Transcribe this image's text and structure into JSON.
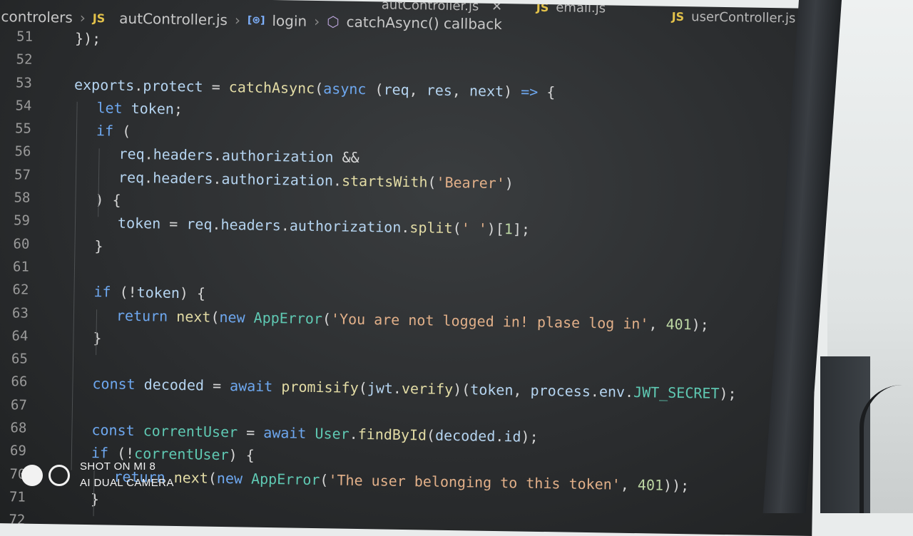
{
  "tabs": [
    {
      "label": "autController.js",
      "active": true,
      "closable": true
    },
    {
      "label": "email.js",
      "active": false
    },
    {
      "label": "userController.js",
      "active": false
    }
  ],
  "breadcrumb": {
    "folder": "controlers",
    "file": "autController.js",
    "symbol": "login",
    "callback": "catchAsync() callback"
  },
  "code": [
    {
      "n": "51",
      "indent": 0,
      "tokens": [
        [
          "pun",
          "});"
        ]
      ]
    },
    {
      "n": "52",
      "indent": 0,
      "tokens": []
    },
    {
      "n": "53",
      "indent": 0,
      "tokens": [
        [
          "var",
          "exports"
        ],
        [
          "pun",
          "."
        ],
        [
          "var",
          "protect"
        ],
        [
          "pun",
          " = "
        ],
        [
          "fn",
          "catchAsync"
        ],
        [
          "pun",
          "("
        ],
        [
          "kw",
          "async"
        ],
        [
          "pun",
          " ("
        ],
        [
          "var",
          "req"
        ],
        [
          "pun",
          ", "
        ],
        [
          "var",
          "res"
        ],
        [
          "pun",
          ", "
        ],
        [
          "var",
          "next"
        ],
        [
          "pun",
          ") "
        ],
        [
          "kw",
          "=>"
        ],
        [
          "pun",
          " {"
        ]
      ]
    },
    {
      "n": "54",
      "indent": 1,
      "tokens": [
        [
          "kw",
          "let"
        ],
        [
          "pun",
          " "
        ],
        [
          "var",
          "token"
        ],
        [
          "pun",
          ";"
        ]
      ]
    },
    {
      "n": "55",
      "indent": 1,
      "tokens": [
        [
          "kw",
          "if"
        ],
        [
          "pun",
          " ("
        ]
      ]
    },
    {
      "n": "56",
      "indent": 2,
      "tokens": [
        [
          "var",
          "req"
        ],
        [
          "pun",
          "."
        ],
        [
          "var",
          "headers"
        ],
        [
          "pun",
          "."
        ],
        [
          "var",
          "authorization"
        ],
        [
          "pun",
          " &&"
        ]
      ]
    },
    {
      "n": "57",
      "indent": 2,
      "tokens": [
        [
          "var",
          "req"
        ],
        [
          "pun",
          "."
        ],
        [
          "var",
          "headers"
        ],
        [
          "pun",
          "."
        ],
        [
          "var",
          "authorization"
        ],
        [
          "pun",
          "."
        ],
        [
          "fn",
          "startsWith"
        ],
        [
          "pun",
          "("
        ],
        [
          "str",
          "'Bearer'"
        ],
        [
          "pun",
          ")"
        ]
      ]
    },
    {
      "n": "58",
      "indent": 1,
      "tokens": [
        [
          "pun",
          ") {"
        ]
      ]
    },
    {
      "n": "59",
      "indent": 2,
      "tokens": [
        [
          "var",
          "token"
        ],
        [
          "pun",
          " = "
        ],
        [
          "var",
          "req"
        ],
        [
          "pun",
          "."
        ],
        [
          "var",
          "headers"
        ],
        [
          "pun",
          "."
        ],
        [
          "var",
          "authorization"
        ],
        [
          "pun",
          "."
        ],
        [
          "fn",
          "split"
        ],
        [
          "pun",
          "("
        ],
        [
          "str",
          "' '"
        ],
        [
          "pun",
          ")["
        ],
        [
          "num",
          "1"
        ],
        [
          "pun",
          "];"
        ]
      ]
    },
    {
      "n": "60",
      "indent": 1,
      "tokens": [
        [
          "pun",
          "}"
        ]
      ]
    },
    {
      "n": "61",
      "indent": 0,
      "tokens": []
    },
    {
      "n": "62",
      "indent": 1,
      "tokens": [
        [
          "kw",
          "if"
        ],
        [
          "pun",
          " (!"
        ],
        [
          "var",
          "token"
        ],
        [
          "pun",
          ") {"
        ]
      ]
    },
    {
      "n": "63",
      "indent": 2,
      "tokens": [
        [
          "kw",
          "return"
        ],
        [
          "pun",
          " "
        ],
        [
          "fn",
          "next"
        ],
        [
          "pun",
          "("
        ],
        [
          "kw",
          "new"
        ],
        [
          "pun",
          " "
        ],
        [
          "cls",
          "AppError"
        ],
        [
          "pun",
          "("
        ],
        [
          "str",
          "'You are not logged in! plase log in'"
        ],
        [
          "pun",
          ", "
        ],
        [
          "num",
          "401"
        ],
        [
          "pun",
          ");"
        ]
      ]
    },
    {
      "n": "64",
      "indent": 1,
      "tokens": [
        [
          "pun",
          "}"
        ]
      ]
    },
    {
      "n": "65",
      "indent": 0,
      "tokens": []
    },
    {
      "n": "66",
      "indent": 1,
      "tokens": [
        [
          "kw",
          "const"
        ],
        [
          "pun",
          " "
        ],
        [
          "var",
          "decoded"
        ],
        [
          "pun",
          " = "
        ],
        [
          "kw",
          "await"
        ],
        [
          "pun",
          " "
        ],
        [
          "fn",
          "promisify"
        ],
        [
          "pun",
          "("
        ],
        [
          "var",
          "jwt"
        ],
        [
          "pun",
          "."
        ],
        [
          "fn",
          "verify"
        ],
        [
          "pun",
          ")("
        ],
        [
          "var",
          "token"
        ],
        [
          "pun",
          ", "
        ],
        [
          "var",
          "process"
        ],
        [
          "pun",
          "."
        ],
        [
          "var",
          "env"
        ],
        [
          "pun",
          "."
        ],
        [
          "const",
          "JWT_SECRET"
        ],
        [
          "pun",
          ");"
        ]
      ]
    },
    {
      "n": "67",
      "indent": 0,
      "tokens": []
    },
    {
      "n": "68",
      "indent": 1,
      "tokens": [
        [
          "kw",
          "const"
        ],
        [
          "pun",
          " "
        ],
        [
          "const",
          "correntUser"
        ],
        [
          "pun",
          " = "
        ],
        [
          "kw",
          "await"
        ],
        [
          "pun",
          " "
        ],
        [
          "cls",
          "User"
        ],
        [
          "pun",
          "."
        ],
        [
          "fn",
          "findById"
        ],
        [
          "pun",
          "("
        ],
        [
          "var",
          "decoded"
        ],
        [
          "pun",
          "."
        ],
        [
          "var",
          "id"
        ],
        [
          "pun",
          ");"
        ]
      ]
    },
    {
      "n": "69",
      "indent": 1,
      "tokens": [
        [
          "kw",
          "if"
        ],
        [
          "pun",
          " (!"
        ],
        [
          "const",
          "correntUser"
        ],
        [
          "pun",
          ") {"
        ]
      ]
    },
    {
      "n": "70",
      "indent": 2,
      "tokens": [
        [
          "kw",
          "return"
        ],
        [
          "pun",
          " "
        ],
        [
          "fn",
          "next"
        ],
        [
          "pun",
          "("
        ],
        [
          "kw",
          "new"
        ],
        [
          "pun",
          " "
        ],
        [
          "cls",
          "AppError"
        ],
        [
          "pun",
          "("
        ],
        [
          "str",
          "'The user belonging to this token'"
        ],
        [
          "pun",
          ", "
        ],
        [
          "num",
          "401"
        ],
        [
          "pun",
          "));"
        ]
      ]
    },
    {
      "n": "71",
      "indent": 1,
      "tokens": [
        [
          "pun",
          "}"
        ]
      ]
    },
    {
      "n": "72",
      "indent": 0,
      "tokens": []
    }
  ],
  "watermark": {
    "line1": "SHOT ON MI 8",
    "line2": "AI DUAL CAMERA"
  }
}
